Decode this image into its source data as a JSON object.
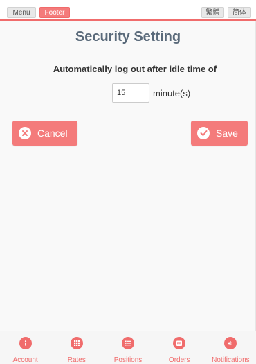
{
  "topbar": {
    "menu_label": "Menu",
    "footer_label": "Footer",
    "traditional_label": "繁體",
    "simplified_label": "简体"
  },
  "page": {
    "title": "Security Setting",
    "description": "Automatically log out after idle time of",
    "idle_value": "15",
    "unit": "minute(s)"
  },
  "actions": {
    "cancel_label": "Cancel",
    "save_label": "Save"
  },
  "footer_nav": {
    "items": [
      {
        "label": "Account",
        "icon": "info-icon"
      },
      {
        "label": "Rates",
        "icon": "grid-icon"
      },
      {
        "label": "Positions",
        "icon": "list-icon"
      },
      {
        "label": "Orders",
        "icon": "calendar-icon"
      },
      {
        "label": "Notifications",
        "icon": "speaker-icon"
      }
    ]
  },
  "colors": {
    "accent": "#f06c6c",
    "title": "#5a6a7a"
  }
}
